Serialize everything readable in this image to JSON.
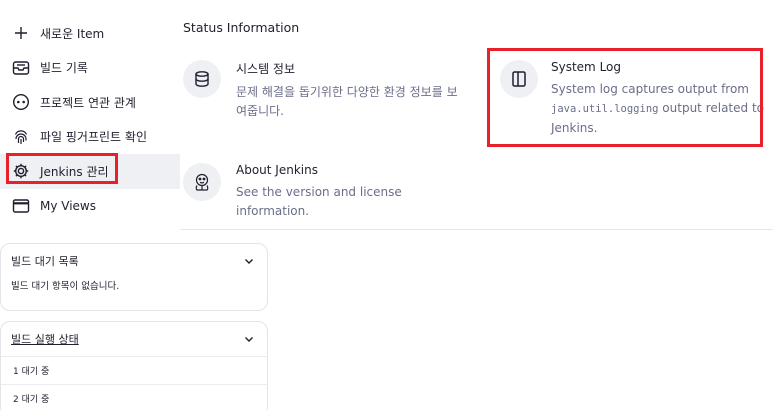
{
  "sidebar": {
    "items": [
      {
        "label": "새로운 Item",
        "icon": "plus-icon"
      },
      {
        "label": "빌드 기록",
        "icon": "inbox-icon"
      },
      {
        "label": "프로젝트 연관 관계",
        "icon": "relationship-icon"
      },
      {
        "label": "파일 핑거프린트 확인",
        "icon": "fingerprint-icon"
      },
      {
        "label": "Jenkins 관리",
        "icon": "gear-icon"
      },
      {
        "label": "My Views",
        "icon": "window-icon"
      }
    ]
  },
  "build_queue": {
    "title": "빌드 대기 목록",
    "empty_text": "빌드 대기 항목이 없습니다."
  },
  "executors": {
    "title": "빌드 실행 상태",
    "rows": [
      "1 대기 중",
      "2 대기 중"
    ]
  },
  "main": {
    "section_title": "Status Information",
    "cards": {
      "system_info": {
        "title": "시스템 정보",
        "desc": "문제 해결을 돕기위한 다양한 환경 정보를 보여줍니다."
      },
      "system_log": {
        "title": "System Log",
        "desc_pre": "System log captures output from",
        "desc_code": "java.util.logging",
        "desc_post": "output related to Jenkins."
      },
      "about": {
        "title": "About Jenkins",
        "desc": "See the version and license information."
      }
    }
  },
  "colors": {
    "highlight": "#e8202a",
    "muted_text": "#6b6e8a",
    "active_bg": "#eef0f4"
  }
}
